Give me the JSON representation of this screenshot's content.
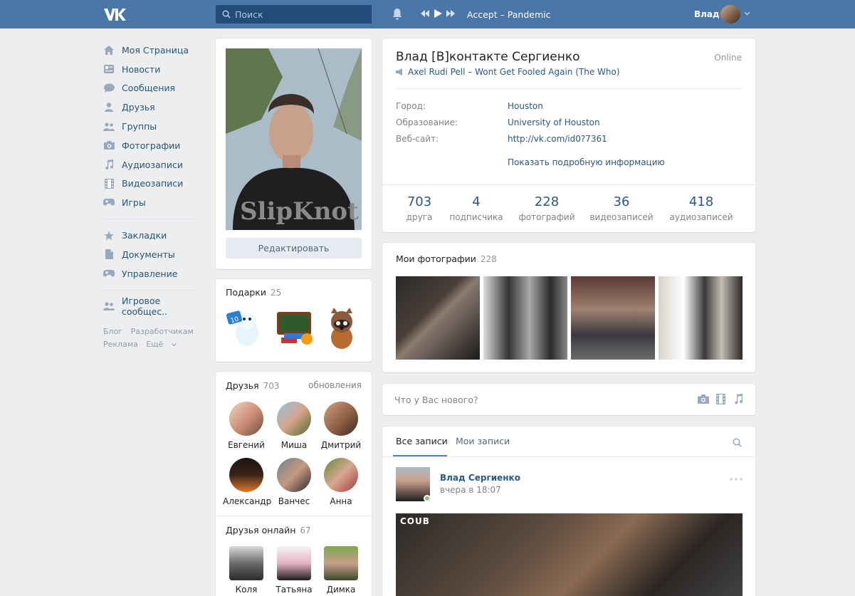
{
  "header": {
    "search_placeholder": "Поиск",
    "now_playing": "Accept – Pandemic",
    "user_name": "Влад"
  },
  "nav": {
    "main": [
      {
        "label": "Моя Страница",
        "icon": "home-icon"
      },
      {
        "label": "Новости",
        "icon": "news-icon"
      },
      {
        "label": "Сообщения",
        "icon": "messages-icon"
      },
      {
        "label": "Друзья",
        "icon": "friend-icon"
      },
      {
        "label": "Группы",
        "icon": "groups-icon"
      },
      {
        "label": "Фотографии",
        "icon": "camera-icon"
      },
      {
        "label": "Аудиозаписи",
        "icon": "music-icon"
      },
      {
        "label": "Видеозаписи",
        "icon": "film-icon"
      },
      {
        "label": "Игры",
        "icon": "gamepad-icon"
      }
    ],
    "secondary": [
      {
        "label": "Закладки",
        "icon": "star-icon"
      },
      {
        "label": "Документы",
        "icon": "document-icon"
      },
      {
        "label": "Управление",
        "icon": "gamepad-icon"
      }
    ],
    "tertiary": [
      {
        "label": "Игровое сообщес..",
        "icon": "groups-icon"
      }
    ],
    "footer": {
      "blog": "Блог",
      "developers": "Разработчикам",
      "ads": "Реклама",
      "more": "Ещё"
    }
  },
  "profile_card": {
    "edit_label": "Редактировать"
  },
  "gifts": {
    "title": "Подарки",
    "count": "25"
  },
  "friends": {
    "title": "Друзья",
    "count": "703",
    "updates_label": "обновления",
    "list": [
      "Евгений",
      "Миша",
      "Дмитрий",
      "Александр",
      "Ванчес",
      "Анна"
    ]
  },
  "friends_online": {
    "title": "Друзья онлайн",
    "count": "67",
    "list": [
      "Коля",
      "Татьяна",
      "Димка"
    ]
  },
  "profile": {
    "name": "Влад [В]контакте Сергиенко",
    "status": "Axel Rudi Pell – Wont Get Fooled Again (The Who)",
    "online": "Online",
    "info": [
      {
        "label": "Город:",
        "value": "Houston"
      },
      {
        "label": "Образование:",
        "value": "University of Houston"
      },
      {
        "label": "Веб-сайт:",
        "value": "http://vk.com/id0?7361"
      }
    ],
    "show_more": "Показать подробную информацию",
    "counters": [
      {
        "num": "703",
        "label": "друга"
      },
      {
        "num": "4",
        "label": "подписчика"
      },
      {
        "num": "228",
        "label": "фотографий"
      },
      {
        "num": "36",
        "label": "видеозаписей"
      },
      {
        "num": "418",
        "label": "аудиозаписей"
      }
    ]
  },
  "photos": {
    "title": "Мои фотографии",
    "count": "228"
  },
  "post_box": {
    "placeholder": "Что у Вас нового?"
  },
  "wall": {
    "tab_all": "Все записи",
    "tab_mine": "Мои записи",
    "post": {
      "author": "Влад Сергиенко",
      "time": "вчера в 18:07",
      "video_logo": "COUB"
    }
  },
  "colors": {
    "header": "#4a76a8",
    "link": "#2a5885",
    "background": "#edeef0"
  }
}
